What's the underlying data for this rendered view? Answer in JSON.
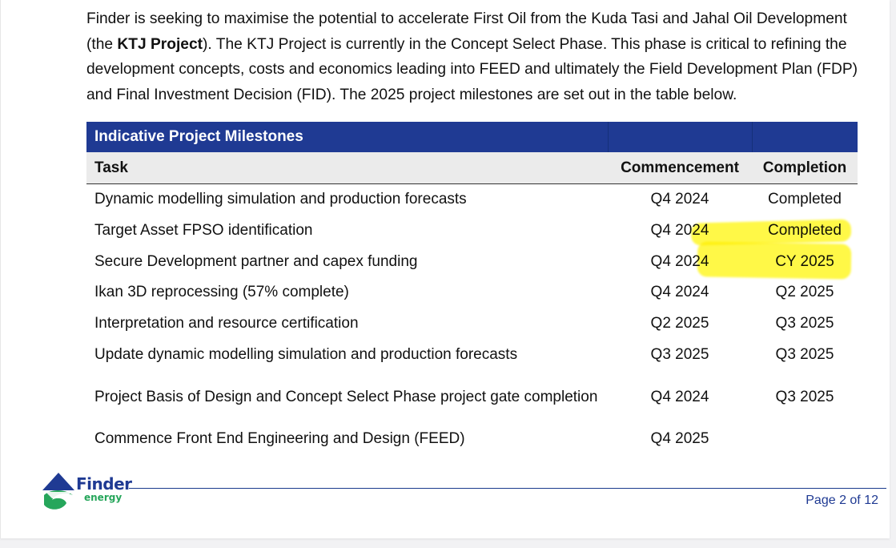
{
  "intro": {
    "part1": "Finder is seeking to maximise the potential to accelerate First Oil from the Kuda Tasi and Jahal Oil Development (the ",
    "bold": "KTJ Project",
    "part2": ").  The KTJ Project is currently in the Concept Select Phase.  This phase is critical to refining the development concepts, costs and economics leading into FEED and ultimately the Field Development Plan (FDP) and Final Investment Decision (FID).  The 2025 project milestones are set out in the table below."
  },
  "table": {
    "title": "Indicative Project Milestones",
    "headers": {
      "task": "Task",
      "commencement": "Commencement",
      "completion": "Completion"
    },
    "rows": [
      {
        "task": "Dynamic modelling simulation and production forecasts",
        "commencement": "Q4 2024",
        "completion": "Completed"
      },
      {
        "task": "Target Asset FPSO identification",
        "commencement": "Q4 2024",
        "completion": "Completed"
      },
      {
        "task": "Secure Development partner and capex funding",
        "commencement": "Q4 2024",
        "completion": "CY 2025"
      },
      {
        "task": "Ikan 3D reprocessing (57% complete)",
        "commencement": "Q4 2024",
        "completion": "Q2 2025"
      },
      {
        "task": "Interpretation and resource certification",
        "commencement": "Q2 2025",
        "completion": "Q3 2025"
      },
      {
        "task": "Update dynamic modelling simulation and production forecasts",
        "commencement": "Q3 2025",
        "completion": "Q3 2025"
      },
      {
        "task": "Project Basis of Design and Concept Select Phase project gate completion",
        "commencement": "Q4 2024",
        "completion": "Q3 2025"
      },
      {
        "task": "Commence Front End Engineering and Design (FEED)",
        "commencement": "Q4 2025",
        "completion": ""
      }
    ]
  },
  "footer": {
    "logo_name": "Finder",
    "logo_sub": "energy",
    "page": "Page 2 of 12"
  },
  "colors": {
    "header_band": "#1f3a93",
    "highlight": "#fff500",
    "logo_green": "#26a65b"
  }
}
